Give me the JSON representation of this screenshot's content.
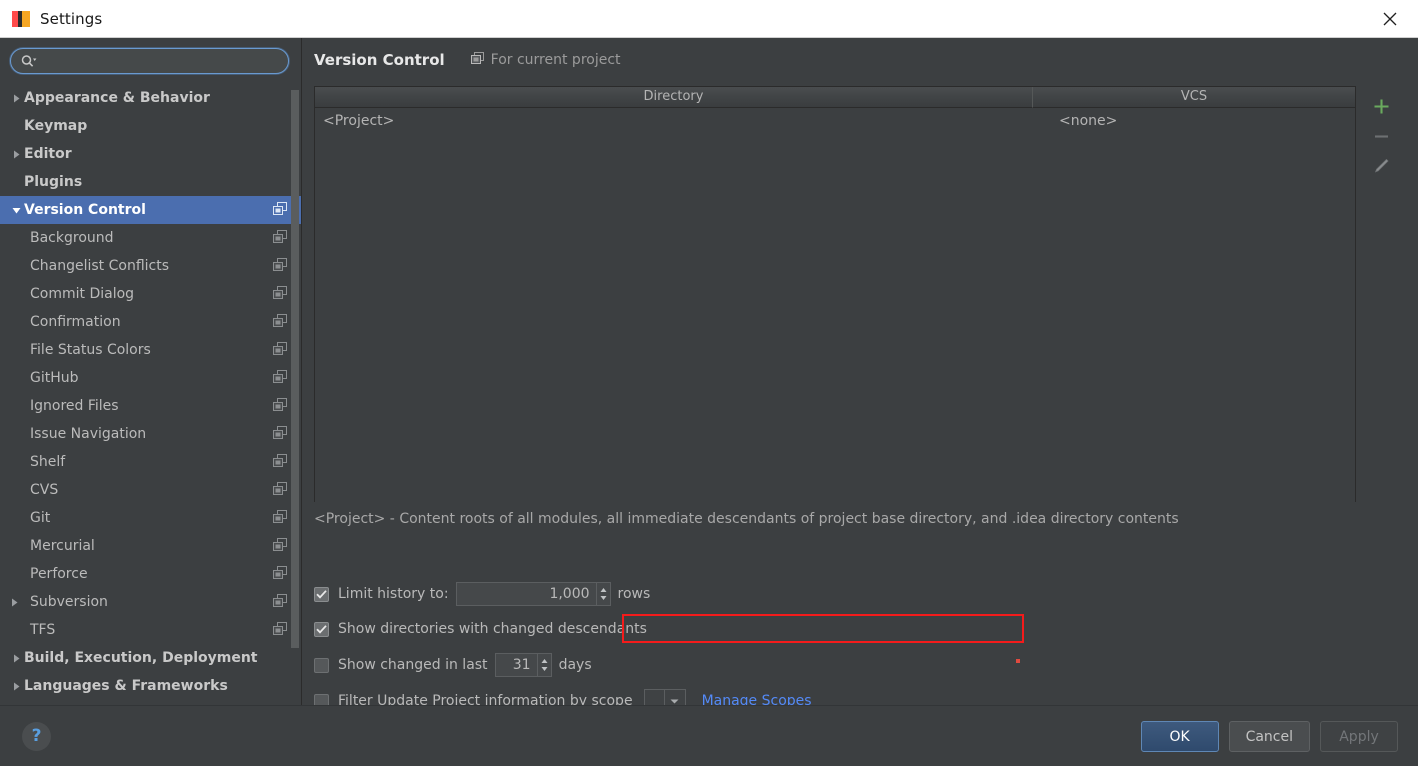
{
  "window": {
    "title": "Settings",
    "app_icon": "intellij-idea-icon",
    "close_icon": "close-icon"
  },
  "search": {
    "value": "",
    "placeholder": "",
    "icon": "search-icon"
  },
  "sidebar": {
    "items": [
      {
        "label": "Appearance & Behavior",
        "level": 0,
        "arrow": "collapsed",
        "selected": false,
        "module_icon": false
      },
      {
        "label": "Keymap",
        "level": 0,
        "arrow": "none",
        "selected": false,
        "module_icon": false
      },
      {
        "label": "Editor",
        "level": 0,
        "arrow": "collapsed",
        "selected": false,
        "module_icon": false
      },
      {
        "label": "Plugins",
        "level": 0,
        "arrow": "none",
        "selected": false,
        "module_icon": false
      },
      {
        "label": "Version Control",
        "level": 0,
        "arrow": "expanded",
        "selected": true,
        "module_icon": true
      },
      {
        "label": "Background",
        "level": 1,
        "arrow": "none",
        "selected": false,
        "module_icon": true
      },
      {
        "label": "Changelist Conflicts",
        "level": 1,
        "arrow": "none",
        "selected": false,
        "module_icon": true
      },
      {
        "label": "Commit Dialog",
        "level": 1,
        "arrow": "none",
        "selected": false,
        "module_icon": true
      },
      {
        "label": "Confirmation",
        "level": 1,
        "arrow": "none",
        "selected": false,
        "module_icon": true
      },
      {
        "label": "File Status Colors",
        "level": 1,
        "arrow": "none",
        "selected": false,
        "module_icon": true
      },
      {
        "label": "GitHub",
        "level": 1,
        "arrow": "none",
        "selected": false,
        "module_icon": true
      },
      {
        "label": "Ignored Files",
        "level": 1,
        "arrow": "none",
        "selected": false,
        "module_icon": true
      },
      {
        "label": "Issue Navigation",
        "level": 1,
        "arrow": "none",
        "selected": false,
        "module_icon": true
      },
      {
        "label": "Shelf",
        "level": 1,
        "arrow": "none",
        "selected": false,
        "module_icon": true
      },
      {
        "label": "CVS",
        "level": 1,
        "arrow": "none",
        "selected": false,
        "module_icon": true
      },
      {
        "label": "Git",
        "level": 1,
        "arrow": "none",
        "selected": false,
        "module_icon": true
      },
      {
        "label": "Mercurial",
        "level": 1,
        "arrow": "none",
        "selected": false,
        "module_icon": true
      },
      {
        "label": "Perforce",
        "level": 1,
        "arrow": "none",
        "selected": false,
        "module_icon": true
      },
      {
        "label": "Subversion",
        "level": 1,
        "arrow": "collapsed",
        "selected": false,
        "module_icon": true
      },
      {
        "label": "TFS",
        "level": 1,
        "arrow": "none",
        "selected": false,
        "module_icon": true
      },
      {
        "label": "Build, Execution, Deployment",
        "level": 0,
        "arrow": "collapsed",
        "selected": false,
        "module_icon": false
      },
      {
        "label": "Languages & Frameworks",
        "level": 0,
        "arrow": "collapsed",
        "selected": false,
        "module_icon": false
      }
    ]
  },
  "main": {
    "title": "Version Control",
    "scope_note": "For current project",
    "scope_note_icon": "project-scope-icon",
    "table": {
      "columns": [
        "Directory",
        "VCS"
      ],
      "rows": [
        {
          "directory": "<Project>",
          "vcs": "<none>"
        }
      ]
    },
    "toolbar": {
      "add_icon": "plus-icon",
      "remove_icon": "minus-icon",
      "edit_icon": "pencil-icon"
    },
    "description": "<Project> - Content roots of all modules, all immediate descendants of project base directory, and .idea directory contents",
    "options": {
      "limit_history": {
        "label": "Limit history to:",
        "checked": true,
        "value": "1,000",
        "suffix": "rows"
      },
      "show_directories": {
        "label": "Show directories with changed descendants",
        "checked": true,
        "highlighted": true
      },
      "show_changed_in_last": {
        "label": "Show changed in last",
        "checked": false,
        "value": "31",
        "suffix": "days"
      },
      "filter_by_scope": {
        "label": "Filter Update Project information by scope",
        "checked": false,
        "selected_scope": "",
        "link_label": "Manage Scopes"
      }
    }
  },
  "footer": {
    "help_label": "?",
    "ok_label": "OK",
    "cancel_label": "Cancel",
    "apply_label": "Apply"
  },
  "colors": {
    "accent_selection": "#4b6eaf",
    "link": "#548af7",
    "highlight_outline": "#f51b1b",
    "add_icon": "#6aaa5e",
    "background": "#3c3f41",
    "titlebar": "#ffffff"
  }
}
